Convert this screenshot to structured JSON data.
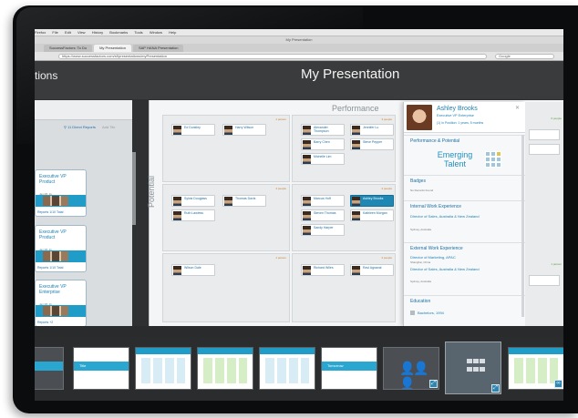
{
  "browser": {
    "menu_items": [
      "Firefox",
      "File",
      "Edit",
      "View",
      "History",
      "Bookmarks",
      "Tools",
      "Window",
      "Help"
    ],
    "window_title": "My Presentation",
    "tabs": [
      {
        "label": "SuccessFactors: To Do"
      },
      {
        "label": "My Presentation"
      },
      {
        "label": "SAP HANA Presentation"
      }
    ],
    "url": "https://www.successfactors.com/sf/presentations/myPresentation",
    "search_placeholder": "Google"
  },
  "app": {
    "left_title": "tions",
    "presentation_title": "My Presentation"
  },
  "org_panel": {
    "direct_reports_link": "11 Direct Reports",
    "add_link": "Add Tile",
    "cards": [
      {
        "title": "Executive VP Product",
        "sub": "Jan 08, 11",
        "footer": "Reports   1/10 Total"
      },
      {
        "title": "Executive VP Product",
        "sub": "Jan 08, 11",
        "footer": "Reports   1/10 Total"
      },
      {
        "title": "Executive VP Enterprise",
        "sub": "Jan 08, 11",
        "footer": "Reports   +2"
      }
    ]
  },
  "grid": {
    "performance_label": "Performance",
    "potential_label": "Potential",
    "cells": [
      {
        "tag": "1 person",
        "people": [
          {
            "name": "Ed Dunkley"
          },
          {
            "name": "Harry Wilson"
          }
        ]
      },
      {
        "tag": "3 people",
        "people": [
          {
            "name": "Alexander Thompson"
          },
          {
            "name": "Jennifer Lu"
          },
          {
            "name": "Barry Chen"
          },
          {
            "name": "Steve Pepper"
          },
          {
            "name": "Michelle Lim"
          }
        ]
      },
      {
        "tag": "2 people",
        "people": [
          {
            "name": "Sylvia Douglass"
          },
          {
            "name": "Thomas Davis"
          },
          {
            "name": "Ruth Lawless"
          }
        ]
      },
      {
        "tag": "2 people",
        "people": [
          {
            "name": "Marcus Hoff"
          },
          {
            "name": "Ashley Brooks"
          },
          {
            "name": "Steven Thomas"
          },
          {
            "name": "Kathleen Morgan"
          },
          {
            "name": "Sandy Harper"
          }
        ]
      },
      {
        "tag": "1 person",
        "people": [
          {
            "name": "Wilson Dale"
          }
        ]
      },
      {
        "tag": "2 people",
        "people": [
          {
            "name": "Richard Wiles"
          },
          {
            "name": "Ravi Agrawal"
          }
        ]
      }
    ]
  },
  "detail": {
    "name": "Ashley Brooks",
    "role": "Executive VP Enterprise",
    "meta": "(1) in Position: 1 years, 5 months",
    "perf_heading": "Performance & Potential",
    "rating": "Emerging Talent",
    "badges_heading": "Badges",
    "badges_empty": "No Records Found",
    "internal_heading": "Internal Work Experience",
    "internal_title": "Director of Sales, Australia & New Zealand",
    "internal_loc": "Sydney, Australia",
    "external_heading": "External Work Experience",
    "external_title1": "Director of Marketing, APAC",
    "external_loc1": "Shanghai, China",
    "external_title2": "Director of Sales, Australia & New Zealand",
    "external_loc2": "Sydney, Australia",
    "education_heading": "Education",
    "education_item": "Bachelors, 1994"
  },
  "right_column": {
    "tags": [
      "6 people",
      "1 person"
    ]
  },
  "filmstrip": {
    "slides": [
      {
        "label": "",
        "kind": "dark-org"
      },
      {
        "label": "Title",
        "kind": "title"
      },
      {
        "label": "",
        "kind": "org"
      },
      {
        "label": "",
        "kind": "org-green"
      },
      {
        "label": "",
        "kind": "boxes"
      },
      {
        "label": "Tomorrow",
        "kind": "title"
      },
      {
        "label": "",
        "kind": "people-icon"
      },
      {
        "label": "",
        "kind": "grid-icon"
      },
      {
        "label": "",
        "kind": "org-link"
      }
    ]
  },
  "colors": {
    "accent": "#1f9cc7",
    "link": "#1c7fb3",
    "bezel": "#0b0c0e",
    "app_bg": "#2f3032"
  }
}
